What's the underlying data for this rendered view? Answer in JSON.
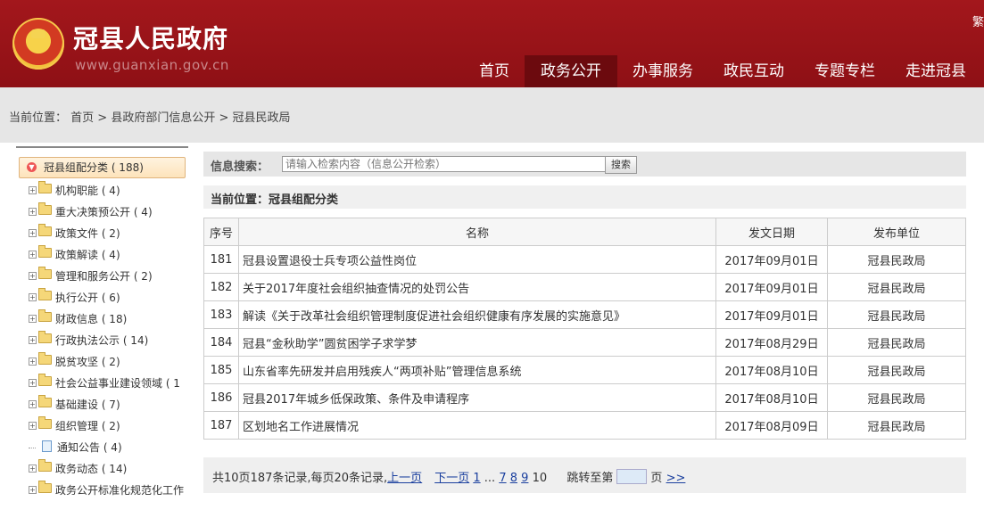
{
  "header": {
    "title": "冠县人民政府",
    "url": "www.guanxian.gov.cn",
    "lang_switch": "繁",
    "nav": [
      "首页",
      "政务公开",
      "办事服务",
      "政民互动",
      "专题专栏",
      "走进冠县"
    ],
    "active_nav": "政务公开"
  },
  "breadcrumb": {
    "prefix": "当前位置：",
    "items": [
      "首页",
      "县政府部门信息公开",
      "冠县民政局"
    ],
    "sep": " > "
  },
  "tree": {
    "root": "冠县组配分类 ( 188)",
    "items": [
      {
        "label": "机构职能 ( 4)",
        "type": "folder"
      },
      {
        "label": "重大决策预公开 ( 4)",
        "type": "folder"
      },
      {
        "label": "政策文件 ( 2)",
        "type": "folder"
      },
      {
        "label": "政策解读 ( 4)",
        "type": "folder"
      },
      {
        "label": "管理和服务公开 ( 2)",
        "type": "folder"
      },
      {
        "label": "执行公开 ( 6)",
        "type": "folder"
      },
      {
        "label": "财政信息 ( 18)",
        "type": "folder"
      },
      {
        "label": "行政执法公示 ( 14)",
        "type": "folder"
      },
      {
        "label": "脱贫攻坚 ( 2)",
        "type": "folder"
      },
      {
        "label": "社会公益事业建设领域 ( 1",
        "type": "folder"
      },
      {
        "label": "基础建设 ( 7)",
        "type": "folder"
      },
      {
        "label": "组织管理 ( 2)",
        "type": "folder"
      },
      {
        "label": "通知公告 ( 4)",
        "type": "doc"
      },
      {
        "label": "政务动态 ( 14)",
        "type": "folder"
      },
      {
        "label": "政务公开标准化规范化工作",
        "type": "folder"
      }
    ]
  },
  "search": {
    "label": "信息搜索：",
    "placeholder": "请输入检索内容（信息公开检索）",
    "button": "搜索"
  },
  "section": {
    "title": "当前位置：冠县组配分类"
  },
  "table": {
    "headers": [
      "序号",
      "名称",
      "发文日期",
      "发布单位"
    ],
    "rows": [
      {
        "no": "181",
        "name": "冠县设置退役士兵专项公益性岗位",
        "date": "2017年09月01日",
        "unit": "冠县民政局"
      },
      {
        "no": "182",
        "name": "关于2017年度社会组织抽查情况的处罚公告",
        "date": "2017年09月01日",
        "unit": "冠县民政局"
      },
      {
        "no": "183",
        "name": "解读《关于改革社会组织管理制度促进社会组织健康有序发展的实施意见》",
        "date": "2017年09月01日",
        "unit": "冠县民政局"
      },
      {
        "no": "184",
        "name": "冠县“金秋助学”圆贫困学子求学梦",
        "date": "2017年08月29日",
        "unit": "冠县民政局"
      },
      {
        "no": "185",
        "name": "山东省率先研发并启用残疾人“两项补贴”管理信息系统",
        "date": "2017年08月10日",
        "unit": "冠县民政局"
      },
      {
        "no": "186",
        "name": "冠县2017年城乡低保政策、条件及申请程序",
        "date": "2017年08月10日",
        "unit": "冠县民政局"
      },
      {
        "no": "187",
        "name": "区划地名工作进展情况",
        "date": "2017年08月09日",
        "unit": "冠县民政局"
      }
    ]
  },
  "pager": {
    "summary": "共10页187条记录,每页20条记录,",
    "prev": "上一页",
    "next": "下一页",
    "first": "1",
    "ellipsis": "...",
    "pages": [
      "7",
      "8",
      "9"
    ],
    "current": "10",
    "jump_prefix": "跳转至第",
    "jump_suffix": "页",
    "go": ">>"
  }
}
